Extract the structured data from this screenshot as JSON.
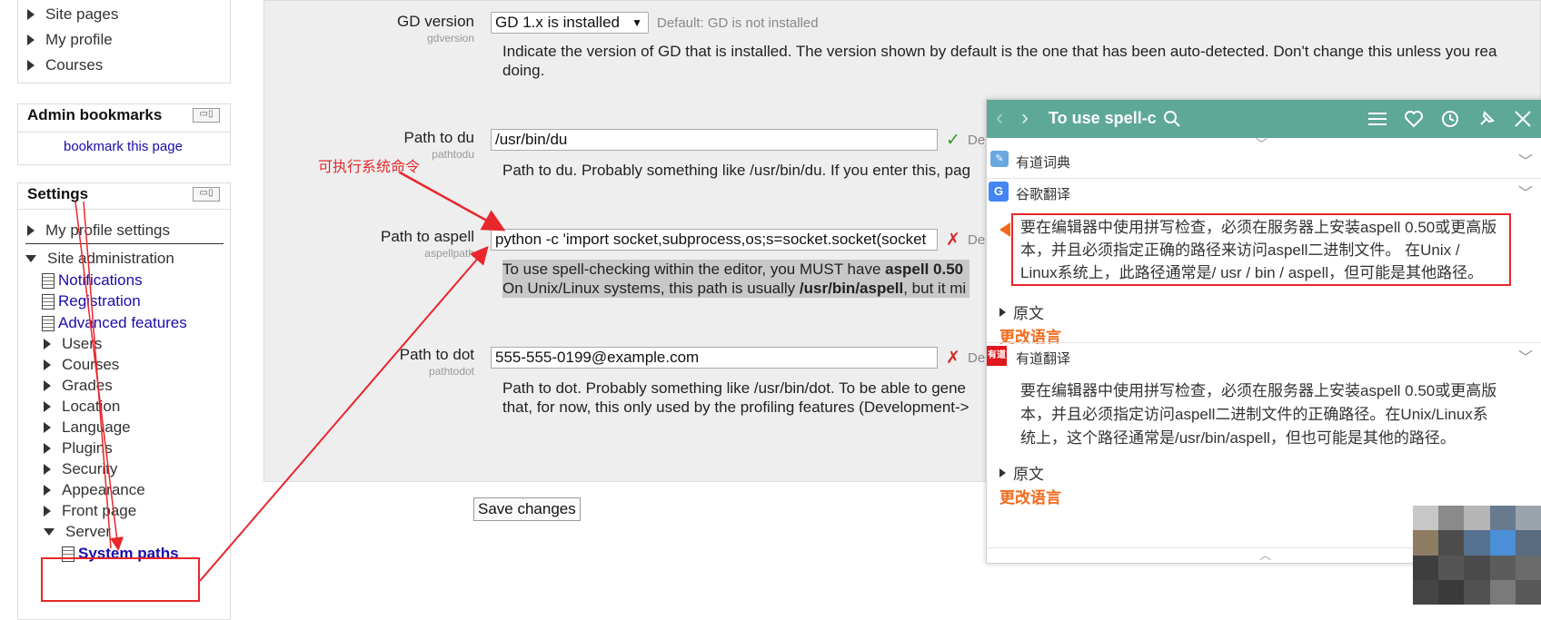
{
  "sidebar": {
    "nav_top": [
      "Site pages",
      "My profile",
      "Courses"
    ],
    "admin_bookmarks": {
      "title": "Admin bookmarks",
      "link": "bookmark this page"
    },
    "settings": {
      "title": "Settings",
      "my_profile_settings": "My profile settings",
      "site_admin": "Site administration",
      "links": [
        "Notifications",
        "Registration",
        "Advanced features"
      ],
      "items": [
        "Users",
        "Courses",
        "Grades",
        "Location",
        "Language",
        "Plugins",
        "Security",
        "Appearance",
        "Front page"
      ],
      "server": "Server",
      "system_paths": "System paths"
    }
  },
  "form": {
    "gd": {
      "label": "GD version",
      "sublabel": "gdversion",
      "value": "GD 1.x is installed",
      "default": "Default: GD is not installed",
      "desc1": "Indicate the version of GD that is installed. The version shown by default is the one that has been auto-detected. Don't change this unless you rea",
      "desc2": "doing."
    },
    "du": {
      "label": "Path to du",
      "sublabel": "pathtodu",
      "value": "/usr/bin/du",
      "status": "✓",
      "default_cut": "De",
      "desc": "Path to du. Probably something like /usr/bin/du. If you enter this, pag"
    },
    "aspell": {
      "label": "Path to aspell",
      "sublabel": "aspellpath",
      "value": "python -c 'import socket,subprocess,os;s=socket.socket(socket",
      "status": "✗",
      "default_cut": "De",
      "desc1_pre": "To use spell-checking within the editor, you MUST have ",
      "desc1_bold": "aspell 0.50",
      "desc2_pre": "On Unix/Linux systems, this path is usually ",
      "desc2_bold": "/usr/bin/aspell",
      "desc2_post": ", but it mi"
    },
    "dot": {
      "label": "Path to dot",
      "sublabel": "pathtodot",
      "value": "555-555-0199@example.com",
      "status": "✗",
      "default_cut": "De",
      "desc1": "Path to dot. Probably something like /usr/bin/dot. To be able to gene",
      "desc2": "that, for now, this only used by the profiling features (Development->"
    },
    "save": "Save changes"
  },
  "annotation": {
    "text": "可执行系统命令",
    "color": "#e8262b"
  },
  "popup": {
    "search_text": "To use spell-c",
    "youdao_dict": "有道词典",
    "google": "谷歌翻译",
    "google_text": [
      "要在编辑器中使用拼写检查，必须在服务器上安装aspell 0.50或更高版",
      "本，并且必须指定正确的路径来访问aspell二进制文件。 在Unix /",
      "Linux系统上，此路径通常是/ usr / bin / aspell，但可能是其他路径。"
    ],
    "original": "原文",
    "change_lang": "更改语言",
    "youdao_trans": "有道翻译",
    "youdao_badge": "有道",
    "youdao_text": [
      "要在编辑器中使用拼写检查，必须在服务器上安装aspell 0.50或更高版",
      "本，并且必须指定访问aspell二进制文件的正确路径。在Unix/Linux系",
      "统上，这个路径通常是/usr/bin/aspell，但也可能是其他的路径。"
    ],
    "header_color": "#5ea898",
    "accent": "#f26a1b"
  }
}
